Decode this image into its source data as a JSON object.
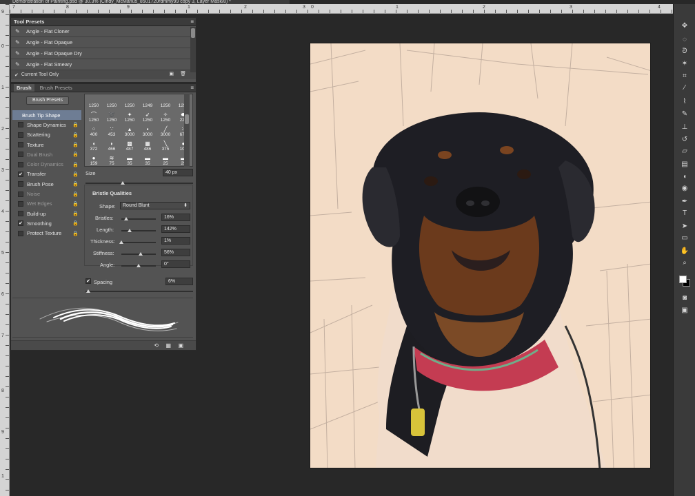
{
  "document": {
    "tab_title": "Demonstration of Painting.psd @ 30.3% (Cindy_McManus_8501720rdmmy99 copy 3, Layer Mask/8) *"
  },
  "rulers": {
    "top_numbers": [
      "7",
      "8",
      "9",
      "1",
      "2",
      "3",
      "0",
      "1",
      "2",
      "3",
      "4",
      "5",
      "6",
      "7",
      "8"
    ],
    "left_numbers": [
      "9",
      "0",
      "1",
      "2",
      "3",
      "4",
      "5",
      "6",
      "7",
      "8",
      "9",
      "1"
    ]
  },
  "tool_presets": {
    "title": "Tool Presets",
    "items": [
      {
        "label": "Angle - Flat Cloner"
      },
      {
        "label": "Angle - Flat Opaque"
      },
      {
        "label": "Angle - Flat Opaque Dry"
      },
      {
        "label": "Angle - Flat Smeary"
      }
    ],
    "current_tool_only": "Current Tool Only"
  },
  "brush_panel": {
    "tabs": [
      "Brush",
      "Brush Presets"
    ],
    "presets_button": "Brush Presets",
    "options": [
      {
        "label": "Brush Tip Shape",
        "checked": null,
        "active": true,
        "dim": false,
        "lock": false
      },
      {
        "label": "Shape Dynamics",
        "checked": false,
        "active": false,
        "dim": false,
        "lock": true
      },
      {
        "label": "Scattering",
        "checked": false,
        "active": false,
        "dim": false,
        "lock": true
      },
      {
        "label": "Texture",
        "checked": false,
        "active": false,
        "dim": false,
        "lock": true
      },
      {
        "label": "Dual Brush",
        "checked": false,
        "active": false,
        "dim": true,
        "lock": true
      },
      {
        "label": "Color Dynamics",
        "checked": false,
        "active": false,
        "dim": true,
        "lock": true
      },
      {
        "label": "Transfer",
        "checked": true,
        "active": false,
        "dim": false,
        "lock": true
      },
      {
        "label": "Brush Pose",
        "checked": false,
        "active": false,
        "dim": false,
        "lock": true
      },
      {
        "label": "Noise",
        "checked": false,
        "active": false,
        "dim": true,
        "lock": true
      },
      {
        "label": "Wet Edges",
        "checked": false,
        "active": false,
        "dim": true,
        "lock": true
      },
      {
        "label": "Build-up",
        "checked": false,
        "active": false,
        "dim": false,
        "lock": true
      },
      {
        "label": "Smoothing",
        "checked": true,
        "active": false,
        "dim": false,
        "lock": true
      },
      {
        "label": "Protect Texture",
        "checked": false,
        "active": false,
        "dim": false,
        "lock": true
      }
    ],
    "tips": [
      {
        "glyph": "",
        "size": "1250"
      },
      {
        "glyph": "",
        "size": "1250"
      },
      {
        "glyph": "",
        "size": "1250"
      },
      {
        "glyph": "",
        "size": "1249"
      },
      {
        "glyph": "",
        "size": "1250"
      },
      {
        "glyph": "",
        "size": "1250"
      },
      {
        "glyph": "⌒",
        "size": "1250"
      },
      {
        "glyph": "➰",
        "size": "1250"
      },
      {
        "glyph": "✦",
        "size": "1250"
      },
      {
        "glyph": "➶",
        "size": "1250"
      },
      {
        "glyph": "✧",
        "size": "1250"
      },
      {
        "glyph": "⬬",
        "size": "226"
      },
      {
        "glyph": "⁘",
        "size": "400"
      },
      {
        "glyph": "∵",
        "size": "453"
      },
      {
        "glyph": "▴",
        "size": "3000"
      },
      {
        "glyph": "▪",
        "size": "3000"
      },
      {
        "glyph": "╱",
        "size": "3000"
      },
      {
        "glyph": "⁙",
        "size": "678"
      },
      {
        "glyph": "◖",
        "size": "372"
      },
      {
        "glyph": "◗",
        "size": "466"
      },
      {
        "glyph": "▩",
        "size": "487"
      },
      {
        "glyph": "▦",
        "size": "486"
      },
      {
        "glyph": "╲",
        "size": "375"
      },
      {
        "glyph": "●",
        "size": "104"
      },
      {
        "glyph": "●",
        "size": "159"
      },
      {
        "glyph": "≋",
        "size": "75"
      },
      {
        "glyph": "▬",
        "size": "35"
      },
      {
        "glyph": "▬",
        "size": "35"
      },
      {
        "glyph": "▬",
        "size": "25"
      },
      {
        "glyph": "▬",
        "size": "25"
      }
    ],
    "size_label": "Size",
    "size_value": "40 px",
    "bristle_title": "Bristle Qualities",
    "shape_label": "Shape:",
    "shape_value": "Round Blunt",
    "bristles_label": "Bristles:",
    "bristles_value": "16%",
    "length_label": "Length:",
    "length_value": "142%",
    "thickness_label": "Thickness:",
    "thickness_value": "1%",
    "stiffness_label": "Stiffness:",
    "stiffness_value": "56%",
    "angle_label": "Angle:",
    "angle_value": "0°",
    "spacing_label": "Spacing",
    "spacing_value": "6%",
    "spacing_checked": true
  },
  "toolbar": {
    "tools": [
      "move-tool",
      "marquee-tool",
      "lasso-tool",
      "quick-select-tool",
      "crop-tool",
      "eyedropper-tool",
      "healing-tool",
      "brush-tool",
      "stamp-tool",
      "history-brush-tool",
      "eraser-tool",
      "gradient-tool",
      "blur-tool",
      "dodge-tool",
      "pen-tool",
      "type-tool",
      "path-select-tool",
      "shape-tool",
      "hand-tool",
      "zoom-tool"
    ],
    "foreground_color": "#ffffff",
    "background_color": "#000000"
  }
}
